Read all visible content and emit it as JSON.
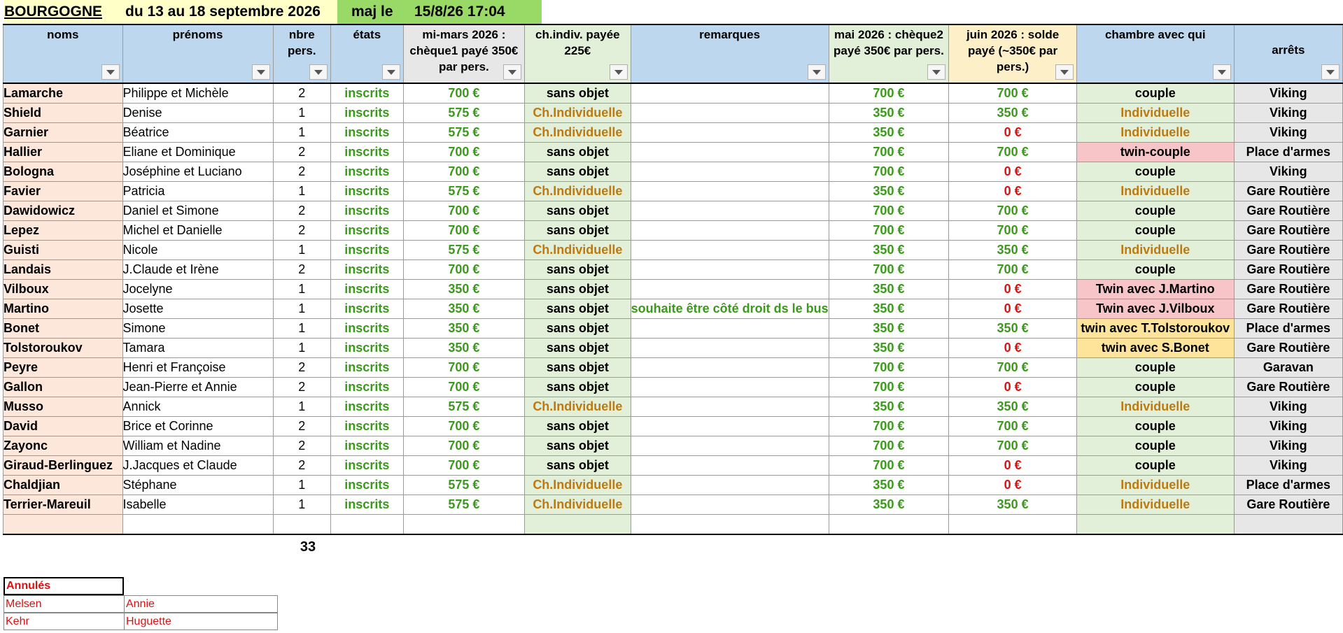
{
  "top": {
    "title": "BOURGOGNE",
    "dates": "du 13 au 18 septembre 2026",
    "maj_label": "maj le",
    "maj_value": "15/8/26 17:04"
  },
  "headers": {
    "noms": "noms",
    "prenoms": "prénoms",
    "nbre": "nbre pers.",
    "etats": "états",
    "mi_mars": "mi-mars 2026 : chèque1 payé 350€ par pers.",
    "chindiv": "ch.indiv. payée 225€",
    "remarques": "remarques",
    "mai": "mai 2026 : chèque2 payé 350€ par pers.",
    "juin": "juin 2026 : solde payé (~350€ par pers.)",
    "chambre": "chambre avec qui",
    "arrets": "arrêts"
  },
  "colors": {
    "green_text": "#3a9a1a",
    "red_text": "#e01010",
    "orange_text": "#bd7a10",
    "header_bg": "#bcd7ee",
    "name_bg": "#fde6da"
  },
  "rows": [
    {
      "nom": "Lamarche",
      "prenom": "Philippe et Michèle",
      "nb": "2",
      "etat": "inscrits",
      "mimars": "700 €",
      "chindiv": "sans objet",
      "remarque": "",
      "mai": "700 €",
      "juin": "700 €",
      "chambre": "couple",
      "arret": "Viking"
    },
    {
      "nom": "Shield",
      "prenom": "Denise",
      "nb": "1",
      "etat": "inscrits",
      "mimars": "575 €",
      "chindiv": "Ch.Individuelle",
      "remarque": "",
      "mai": "350 €",
      "juin": "350 €",
      "chambre": "Individuelle",
      "arret": "Viking"
    },
    {
      "nom": "Garnier",
      "prenom": "Béatrice",
      "nb": "1",
      "etat": "inscrits",
      "mimars": "575 €",
      "chindiv": "Ch.Individuelle",
      "remarque": "",
      "mai": "350 €",
      "juin": "0 €",
      "chambre": "Individuelle",
      "arret": "Viking"
    },
    {
      "nom": "Hallier",
      "prenom": "Eliane et Dominique",
      "nb": "2",
      "etat": "inscrits",
      "mimars": "700 €",
      "chindiv": "sans objet",
      "remarque": "",
      "mai": "700 €",
      "juin": "700 €",
      "chambre": "twin-couple",
      "arret": "Place d'armes"
    },
    {
      "nom": "Bologna",
      "prenom": "Joséphine et Luciano",
      "nb": "2",
      "etat": "inscrits",
      "mimars": "700 €",
      "chindiv": "sans objet",
      "remarque": "",
      "mai": "700 €",
      "juin": "0 €",
      "chambre": "couple",
      "arret": "Viking"
    },
    {
      "nom": "Favier",
      "prenom": "Patricia",
      "nb": "1",
      "etat": "inscrits",
      "mimars": "575 €",
      "chindiv": "Ch.Individuelle",
      "remarque": "",
      "mai": "350 €",
      "juin": "0 €",
      "chambre": "Individuelle",
      "arret": "Gare Routière"
    },
    {
      "nom": "Dawidowicz",
      "prenom": "Daniel et Simone",
      "nb": "2",
      "etat": "inscrits",
      "mimars": "700 €",
      "chindiv": "sans objet",
      "remarque": "",
      "mai": "700 €",
      "juin": "700 €",
      "chambre": "couple",
      "arret": "Gare Routière"
    },
    {
      "nom": "Lepez",
      "prenom": "Michel et Danielle",
      "nb": "2",
      "etat": "inscrits",
      "mimars": "700 €",
      "chindiv": "sans objet",
      "remarque": "",
      "mai": "700 €",
      "juin": "700 €",
      "chambre": "couple",
      "arret": "Gare Routière"
    },
    {
      "nom": "Guisti",
      "prenom": "Nicole",
      "nb": "1",
      "etat": "inscrits",
      "mimars": "575 €",
      "chindiv": "Ch.Individuelle",
      "remarque": "",
      "mai": "350 €",
      "juin": "350 €",
      "chambre": "Individuelle",
      "arret": "Gare Routière"
    },
    {
      "nom": "Landais",
      "prenom": "J.Claude et Irène",
      "nb": "2",
      "etat": "inscrits",
      "mimars": "700 €",
      "chindiv": "sans objet",
      "remarque": "",
      "mai": "700 €",
      "juin": "700 €",
      "chambre": "couple",
      "arret": "Gare Routière"
    },
    {
      "nom": "Vilboux",
      "prenom": "Jocelyne",
      "nb": "1",
      "etat": "inscrits",
      "mimars": "350 €",
      "chindiv": "sans objet",
      "remarque": "",
      "mai": "350 €",
      "juin": "0 €",
      "chambre": "Twin avec J.Martino",
      "arret": "Gare Routière"
    },
    {
      "nom": "Martino",
      "prenom": "Josette",
      "nb": "1",
      "etat": "inscrits",
      "mimars": "350 €",
      "chindiv": "sans objet",
      "remarque": "souhaite être côté droit ds le bus",
      "mai": "350 €",
      "juin": "0 €",
      "chambre": "Twin avec J.Vilboux",
      "arret": "Gare Routière"
    },
    {
      "nom": "Bonet",
      "prenom": "Simone",
      "nb": "1",
      "etat": "inscrits",
      "mimars": "350 €",
      "chindiv": "sans objet",
      "remarque": "",
      "mai": "350 €",
      "juin": "350 €",
      "chambre": "twin avec T.Tolstoroukov",
      "arret": "Place d'armes"
    },
    {
      "nom": "Tolstoroukov",
      "prenom": "Tamara",
      "nb": "1",
      "etat": "inscrits",
      "mimars": "350 €",
      "chindiv": "sans objet",
      "remarque": "",
      "mai": "350 €",
      "juin": "0 €",
      "chambre": "twin avec S.Bonet",
      "arret": "Gare Routière"
    },
    {
      "nom": "Peyre",
      "prenom": "Henri et Françoise",
      "nb": "2",
      "etat": "inscrits",
      "mimars": "700 €",
      "chindiv": "sans objet",
      "remarque": "",
      "mai": "700 €",
      "juin": "700 €",
      "chambre": "couple",
      "arret": "Garavan"
    },
    {
      "nom": "Gallon",
      "prenom": "Jean-Pierre et Annie",
      "nb": "2",
      "etat": "inscrits",
      "mimars": "700 €",
      "chindiv": "sans objet",
      "remarque": "",
      "mai": "700 €",
      "juin": "0 €",
      "chambre": "couple",
      "arret": "Gare Routière"
    },
    {
      "nom": "Musso",
      "prenom": "Annick",
      "nb": "1",
      "etat": "inscrits",
      "mimars": "575 €",
      "chindiv": "Ch.Individuelle",
      "remarque": "",
      "mai": "350 €",
      "juin": "350 €",
      "chambre": "Individuelle",
      "arret": "Viking"
    },
    {
      "nom": "David",
      "prenom": "Brice et Corinne",
      "nb": "2",
      "etat": "inscrits",
      "mimars": "700 €",
      "chindiv": "sans objet",
      "remarque": "",
      "mai": "700 €",
      "juin": "700 €",
      "chambre": "couple",
      "arret": "Viking"
    },
    {
      "nom": "Zayonc",
      "prenom": "William et Nadine",
      "nb": "2",
      "etat": "inscrits",
      "mimars": "700 €",
      "chindiv": "sans objet",
      "remarque": "",
      "mai": "700 €",
      "juin": "700 €",
      "chambre": "couple",
      "arret": "Viking"
    },
    {
      "nom": "Giraud-Berlinguez",
      "prenom": "J.Jacques et Claude",
      "nb": "2",
      "etat": "inscrits",
      "mimars": "700 €",
      "chindiv": "sans objet",
      "remarque": "",
      "mai": "700 €",
      "juin": "0 €",
      "chambre": "couple",
      "arret": "Viking"
    },
    {
      "nom": "Chaldjian",
      "prenom": "Stéphane",
      "nb": "1",
      "etat": "inscrits",
      "mimars": "575 €",
      "chindiv": "Ch.Individuelle",
      "remarque": "",
      "mai": "350 €",
      "juin": "0 €",
      "chambre": "Individuelle",
      "arret": "Place d'armes"
    },
    {
      "nom": "Terrier-Mareuil",
      "prenom": "Isabelle",
      "nb": "1",
      "etat": "inscrits",
      "mimars": "575 €",
      "chindiv": "Ch.Individuelle",
      "remarque": "",
      "mai": "350 €",
      "juin": "350 €",
      "chambre": "Individuelle",
      "arret": "Gare Routière"
    }
  ],
  "total_personnes": "33",
  "annules": {
    "title": "Annulés",
    "items": [
      {
        "nom": "Melsen",
        "prenom": "Annie"
      },
      {
        "nom": "Kehr",
        "prenom": "Huguette"
      }
    ]
  }
}
